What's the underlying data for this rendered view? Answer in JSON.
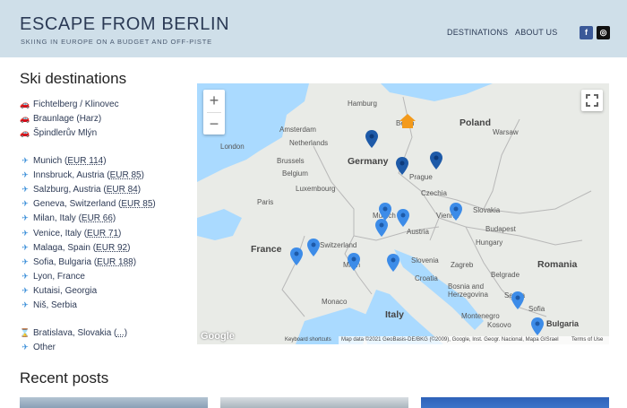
{
  "header": {
    "title": "ESCAPE FROM BERLIN",
    "tagline": "SKIING IN EUROPE ON A BUDGET AND OFF-PISTE",
    "nav": [
      "DESTINATIONS",
      "ABOUT US"
    ],
    "social": {
      "facebook": "f",
      "instagram": "◎"
    }
  },
  "sidebar": {
    "title": "Ski destinations",
    "car_items": [
      {
        "icon": "car-icon",
        "text": "Fichtelberg / Klinovec"
      },
      {
        "icon": "car-icon",
        "text": "Braunlage (Harz)"
      },
      {
        "icon": "car-icon",
        "text": "Špindlerův Mlýn"
      }
    ],
    "flight_items": [
      {
        "name": "Munich (",
        "price": "EUR 114",
        "close": ")"
      },
      {
        "name": "Innsbruck, Austria (",
        "price": "EUR 85",
        "close": ")"
      },
      {
        "name": "Salzburg, Austria (",
        "price": "EUR 84",
        "close": ")"
      },
      {
        "name": "Geneva, Switzerland (",
        "price": "EUR 85",
        "close": ")"
      },
      {
        "name": "Milan, Italy (",
        "price": "EUR 66",
        "close": ")"
      },
      {
        "name": "Venice, Italy (",
        "price": "EUR 71",
        "close": ")"
      },
      {
        "name": "Malaga, Spain (",
        "price": "EUR 92",
        "close": ")"
      },
      {
        "name": "Sofia, Bulgaria (",
        "price": "EUR 188",
        "close": ")"
      },
      {
        "name": "Lyon, France",
        "price": "",
        "close": ""
      },
      {
        "name": "Kutaisi, Georgia",
        "price": "",
        "close": ""
      },
      {
        "name": "Niš, Serbia",
        "price": "",
        "close": ""
      }
    ],
    "other_items": [
      {
        "icon": "hourglass-icon",
        "name": "Bratislava, Slovakia (",
        "price": "...",
        "close": ")"
      },
      {
        "icon": "plane-icon",
        "name": "Other",
        "price": "",
        "close": ""
      }
    ]
  },
  "map": {
    "zoom_in": "+",
    "zoom_out": "−",
    "countries": [
      "Poland",
      "Germany",
      "France",
      "Italy",
      "Romania",
      "Czechia",
      "Slovakia",
      "Austria",
      "Hungary",
      "Bulgaria",
      "Belgium",
      "Netherlands",
      "Switzerland",
      "Luxembourg",
      "Croatia",
      "Slovenia",
      "Serbia"
    ],
    "cities": [
      "Hamburg",
      "Berlin",
      "Warsaw",
      "London",
      "Amsterdam",
      "Brussels",
      "Paris",
      "Prague",
      "Munich",
      "Vienna",
      "Zagreb",
      "Belgrade",
      "Milan",
      "Monaco",
      "Sofia",
      "Montenegro",
      "Kosovo",
      "Bosnia and Herzegovina",
      "Budapest"
    ],
    "attribution": "Map data ©2021 GeoBasis-DE/BKG (©2009), Google, Inst. Geogr. Nacional, Mapa GISrael",
    "keyboard": "Keyboard shortcuts",
    "terms": "Terms of Use",
    "google": "Google"
  },
  "recent": {
    "title": "Recent posts"
  }
}
